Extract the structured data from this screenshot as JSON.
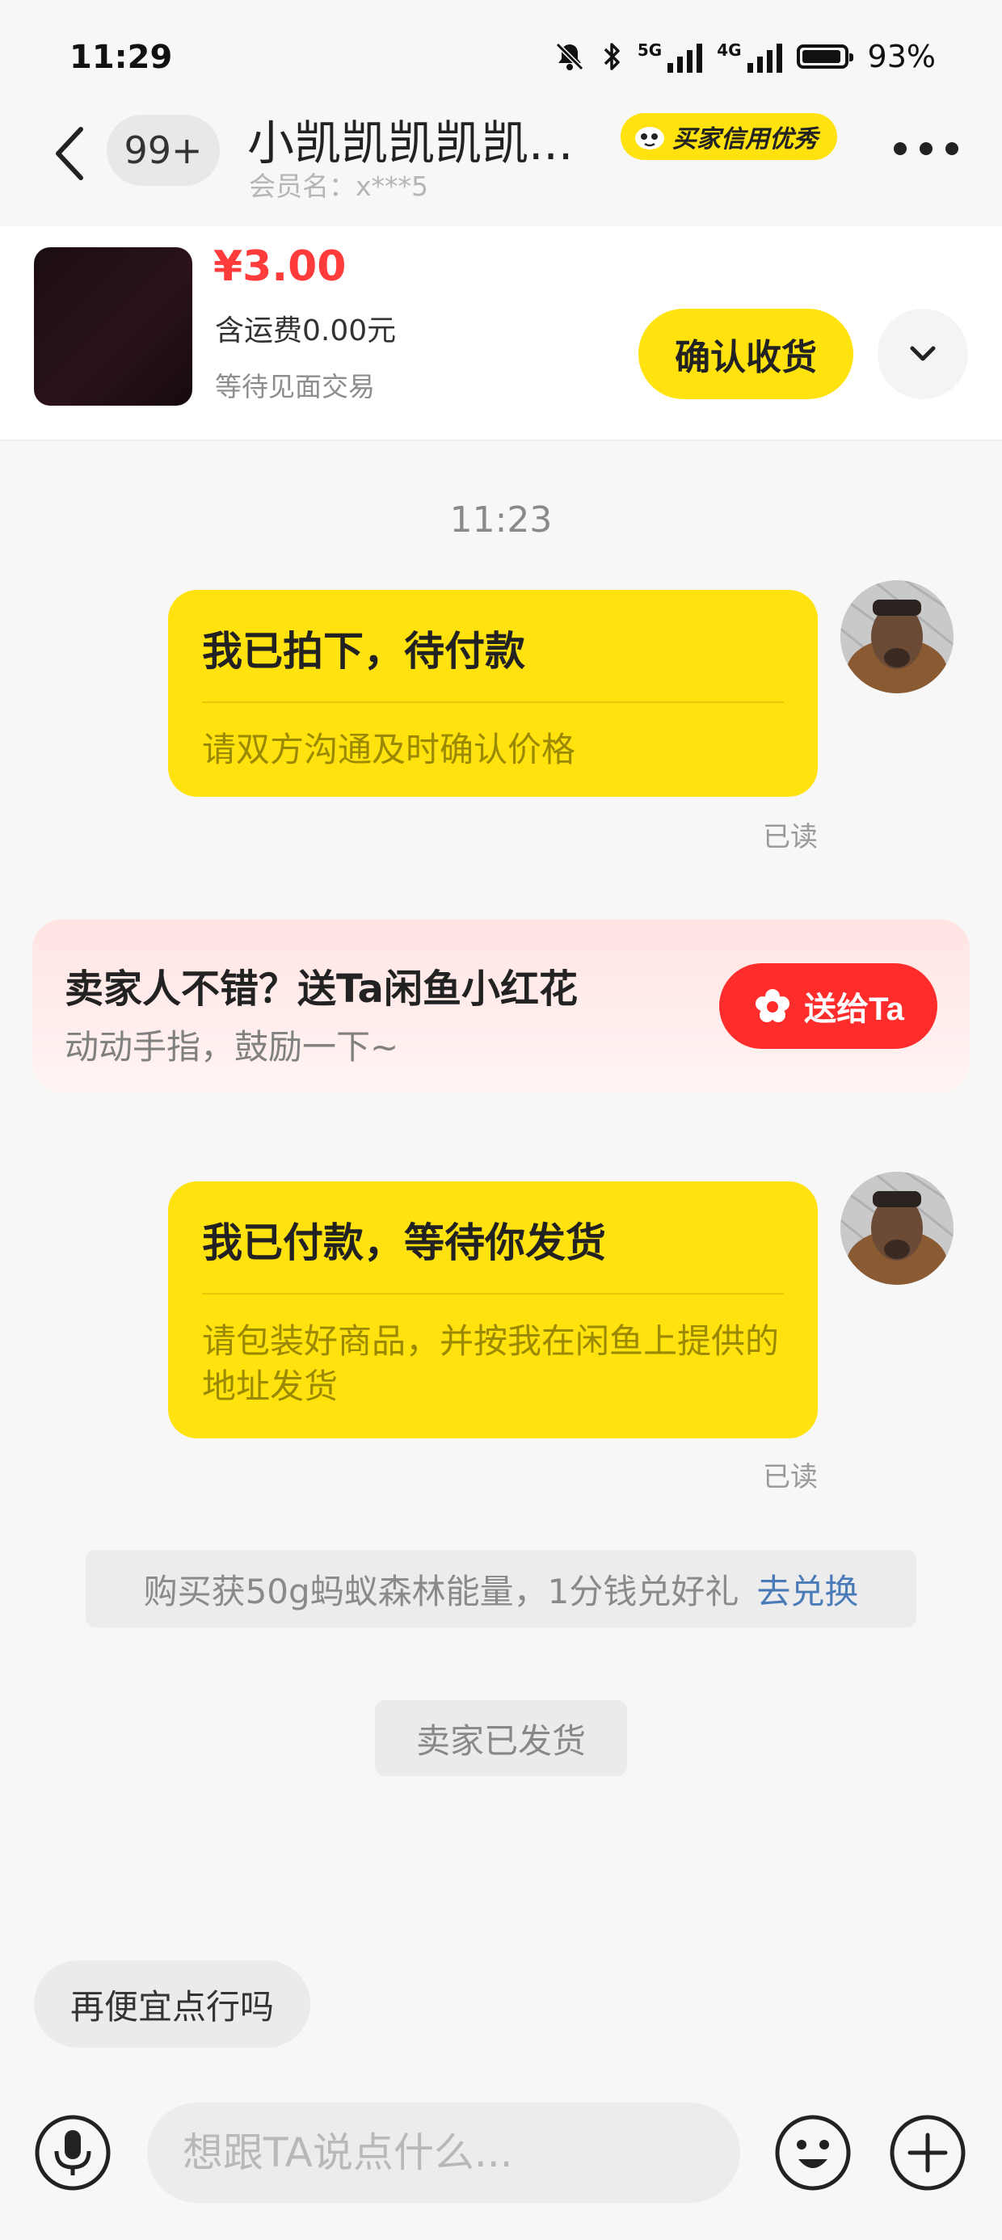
{
  "status_bar": {
    "time": "11:29",
    "net1": "5G",
    "net2": "4G",
    "battery": "93%",
    "icons": [
      "mute-bell-icon",
      "bluetooth-icon",
      "signal-icon",
      "signal-icon",
      "battery-icon"
    ]
  },
  "header": {
    "unread_count": "99+",
    "chat_name": "小凯凯凯凯凯...",
    "member_id": "会员名：x***5",
    "credit_badge": "买家信用优秀"
  },
  "order": {
    "price": "¥3.00",
    "shipping": "含运费0.00元",
    "status": "等待见面交易",
    "confirm_label": "确认收货"
  },
  "chat": {
    "timestamp": "11:23",
    "messages": [
      {
        "title": "我已拍下，待付款",
        "sub": "请双方沟通及时确认价格",
        "read": "已读"
      },
      {
        "title": "我已付款，等待你发货",
        "sub": "请包装好商品，并按我在闲鱼上提供的地址发货",
        "read": "已读"
      }
    ],
    "flower_card": {
      "title": "卖家人不错？送Ta闲鱼小红花",
      "sub": "动动手指，鼓励一下~",
      "button": "送给Ta"
    },
    "promo": {
      "text": "购买获50g蚂蚁森林能量，1分钱兑好礼",
      "link": "去兑换"
    },
    "shipped_notice": "卖家已发货"
  },
  "quick_reply": "再便宜点行吗",
  "input": {
    "placeholder": "想跟TA说点什么..."
  },
  "colors": {
    "accent_yellow": "#ffe20e",
    "price_red": "#ff3b3b",
    "gift_red": "#ff2c2c",
    "link_blue": "#4a7bb8"
  }
}
